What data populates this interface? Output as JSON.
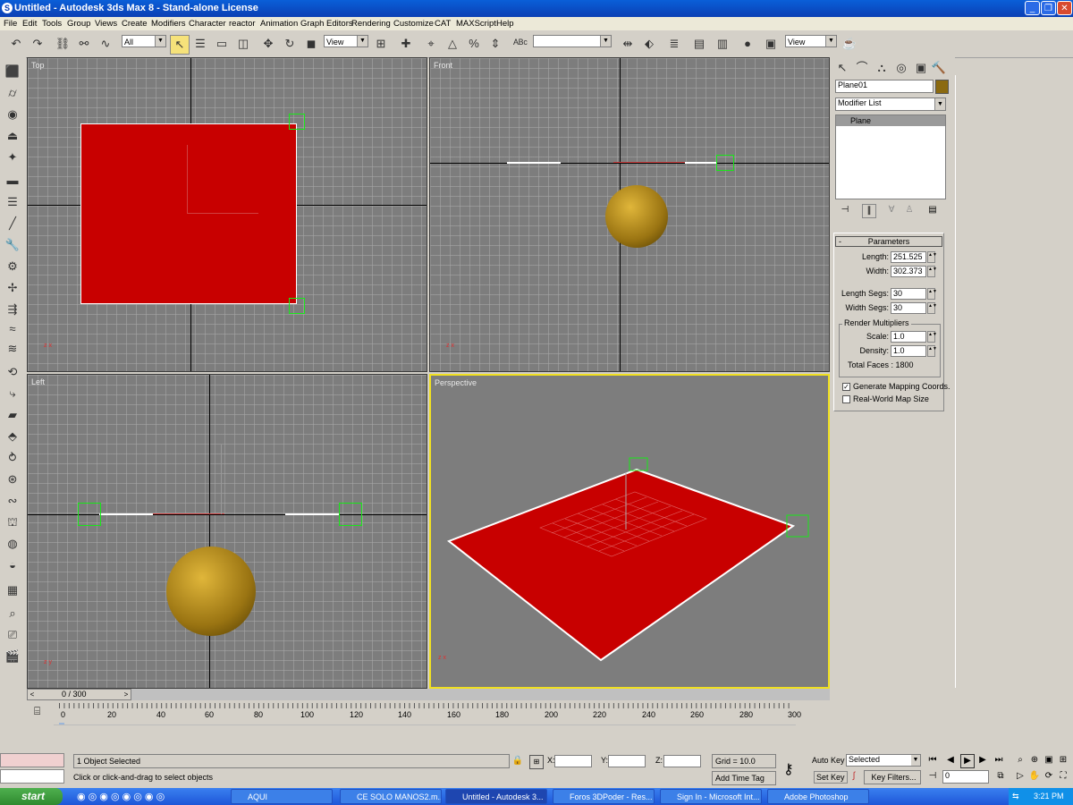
{
  "window": {
    "title": "Untitled - Autodesk 3ds Max 8  - Stand-alone License",
    "app_icon": "3ds-max-icon"
  },
  "menu": [
    "File",
    "Edit",
    "Tools",
    "Group",
    "Views",
    "Create",
    "Modifiers",
    "Character",
    "reactor",
    "Animation",
    "Graph Editors",
    "Rendering",
    "Customize",
    "CAT",
    "MAXScript",
    "Help"
  ],
  "toolbar": {
    "selection_filter": "All",
    "ref_coord": "View",
    "named_sel": "",
    "render_view": "View"
  },
  "viewports": {
    "top": {
      "label": "Top",
      "axis_a": "z",
      "axis_b": "x"
    },
    "front": {
      "label": "Front",
      "axis_a": "z",
      "axis_b": "x"
    },
    "left": {
      "label": "Left",
      "axis_a": "z",
      "axis_b": "y"
    },
    "perspective": {
      "label": "Perspective",
      "axis_a": "z",
      "axis_b": "x"
    }
  },
  "panel": {
    "object_name": "Plane01",
    "object_color": "#8b6a10",
    "modifier_list": "Modifier List",
    "stack_item": "Plane",
    "rollout_toggle": "-",
    "rollout_title": "Parameters",
    "length_label": "Length:",
    "length": "251.525",
    "width_label": "Width:",
    "width": "302.373",
    "length_segs_label": "Length Segs:",
    "length_segs": "30",
    "width_segs_label": "Width Segs:",
    "width_segs": "30",
    "render_group": "Render Multipliers",
    "scale_label": "Scale:",
    "scale": "1.0",
    "density_label": "Density:",
    "density": "1.0",
    "total_faces": "Total Faces : 1800",
    "gen_mapping": "Generate Mapping Coords.",
    "gen_mapping_checked": true,
    "real_world": "Real-World Map Size",
    "real_world_checked": false
  },
  "timeline": {
    "slider": "0 / 300",
    "ticks": [
      "0",
      "20",
      "40",
      "60",
      "80",
      "100",
      "120",
      "140",
      "160",
      "180",
      "200",
      "220",
      "240",
      "260",
      "280",
      "300"
    ]
  },
  "status": {
    "selection": "1 Object Selected",
    "prompt": "Click or click-and-drag to select objects",
    "x_label": "X:",
    "y_label": "Y:",
    "z_label": "Z:",
    "grid": "Grid = 10.0",
    "add_time_tag": "Add Time Tag",
    "auto_key": "Auto Key",
    "set_key": "Set Key",
    "selected": "Selected",
    "key_filters": "Key Filters...",
    "frame": "0"
  },
  "taskbar": {
    "start": "start",
    "tasks": [
      "AQUI",
      "CE SOLO MANOS2.m...",
      "Untitled - Autodesk 3...",
      "Foros 3DPoder - Res...",
      "Sign In - Microsoft Int...",
      "Adobe Photoshop"
    ],
    "clock": "3:21 PM"
  },
  "colors": {
    "plane": "#c80000",
    "selection_bracket": "#19e819",
    "active_border": "#f0e020",
    "viewport_bg": "#7d7d7d"
  }
}
